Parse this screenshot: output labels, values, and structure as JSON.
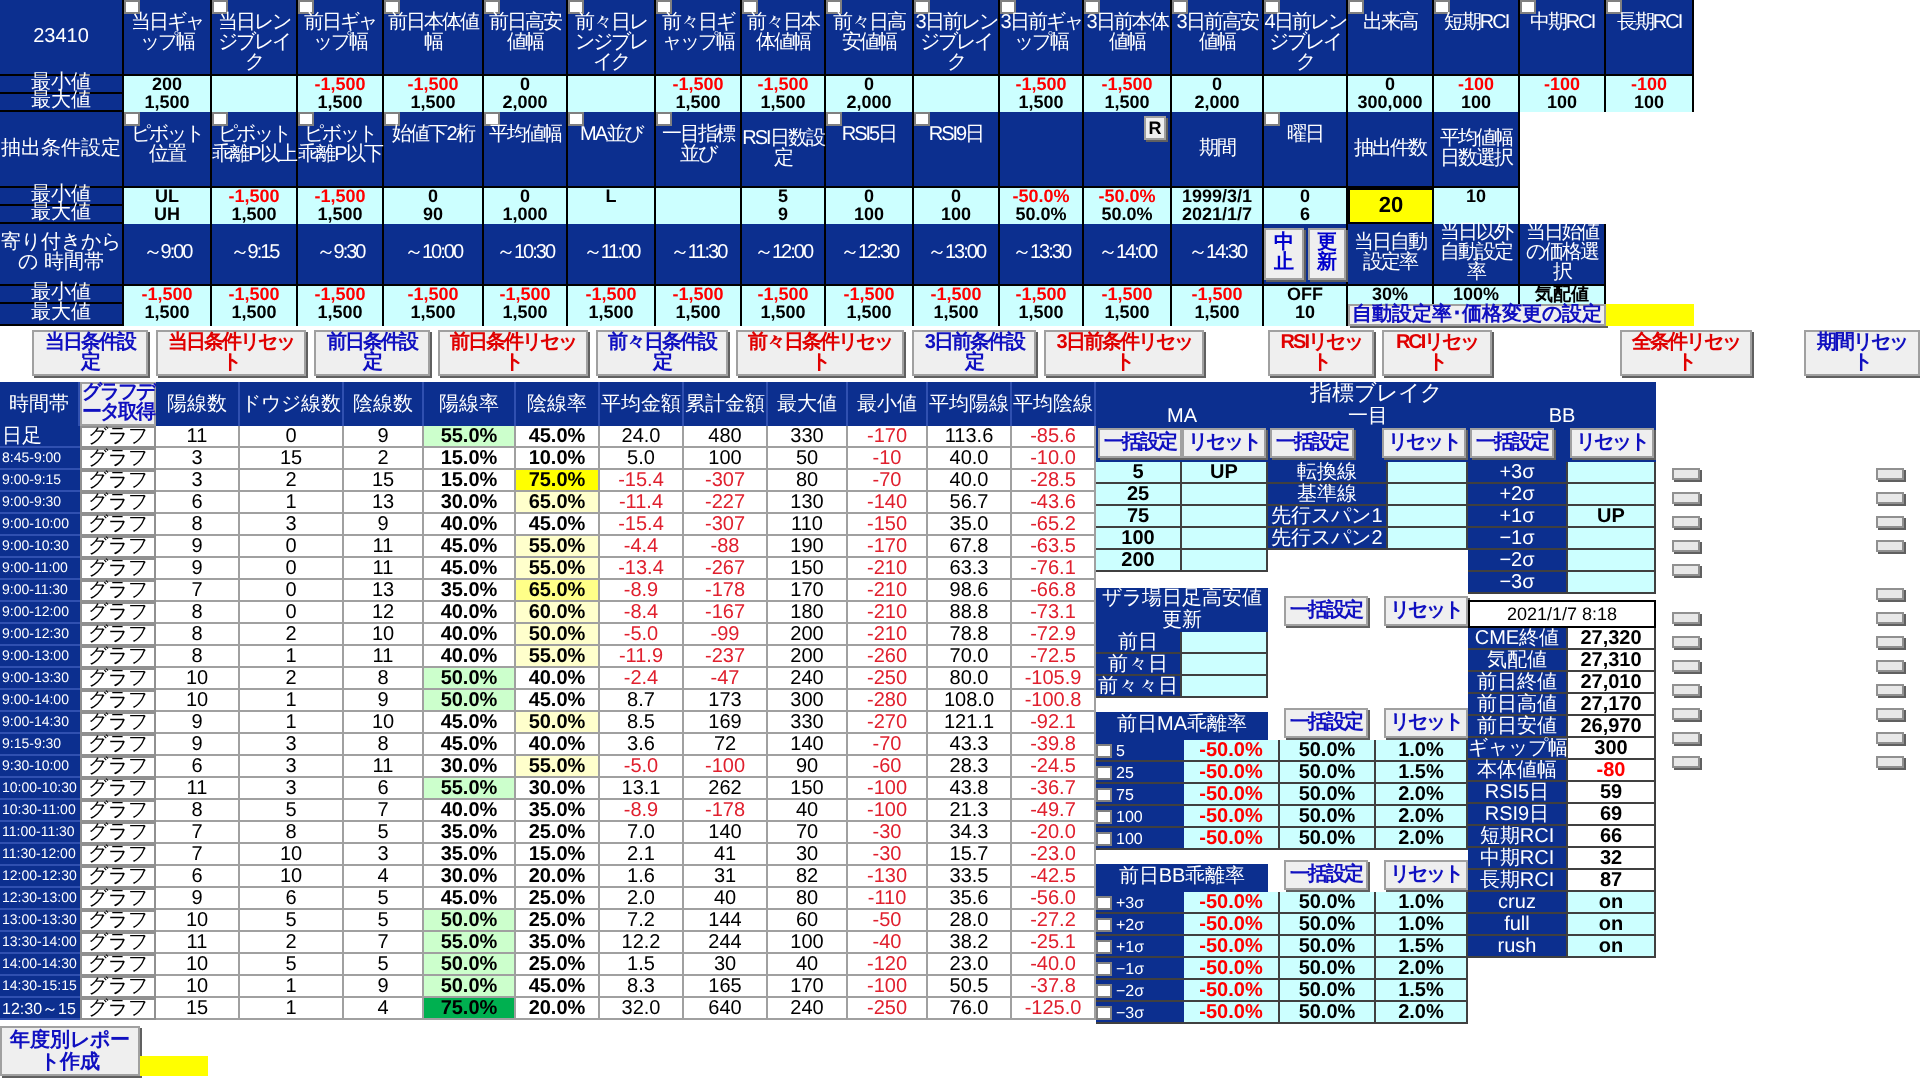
{
  "bands": [
    {
      "label": "23410",
      "min_label": "最小値",
      "max_label": "最大値",
      "columns": [
        {
          "kind": "check",
          "label": "当日ギャップ幅",
          "checked": false,
          "min": "200",
          "max": "1,500"
        },
        {
          "kind": "check",
          "label": "当日レンジブレイク",
          "checked": false
        },
        {
          "kind": "check",
          "label": "前日ギャップ幅",
          "checked": false,
          "min": "-1,500",
          "max": "1,500"
        },
        {
          "kind": "check",
          "label": "前日本体値幅",
          "checked": false,
          "min": "-1,500",
          "max": "1,500"
        },
        {
          "kind": "check",
          "label": "前日高安値幅",
          "checked": false,
          "min": "0",
          "max": "2,000"
        },
        {
          "kind": "check",
          "label": "前々日レンジブレイク",
          "checked": false
        },
        {
          "kind": "check",
          "label": "前々日ギャップ幅",
          "checked": false,
          "min": "-1,500",
          "max": "1,500"
        },
        {
          "kind": "check",
          "label": "前々日本体値幅",
          "checked": false,
          "min": "-1,500",
          "max": "1,500"
        },
        {
          "kind": "check",
          "label": "前々日高安値幅",
          "checked": false,
          "min": "0",
          "max": "2,000"
        },
        {
          "kind": "check",
          "label": "3日前レンジブレイク",
          "checked": false
        },
        {
          "kind": "check",
          "label": "3日前ギャップ幅",
          "checked": false,
          "min": "-1,500",
          "max": "1,500"
        },
        {
          "kind": "check",
          "label": "3日前本体値幅",
          "checked": false,
          "min": "-1,500",
          "max": "1,500"
        },
        {
          "kind": "check",
          "label": "3日前高安値幅",
          "checked": false,
          "min": "0",
          "max": "2,000"
        },
        {
          "kind": "check",
          "label": "4日前レンジブレイク",
          "checked": false
        },
        {
          "kind": "check",
          "label": "出来高",
          "checked": false,
          "min": "0",
          "max": "300,000"
        },
        {
          "kind": "check",
          "label": "短期RCI",
          "checked": false,
          "min": "-100",
          "max": "100"
        },
        {
          "kind": "check",
          "label": "中期RCI",
          "checked": false,
          "min": "-100",
          "max": "100"
        },
        {
          "kind": "check",
          "label": "長期RCI",
          "checked": false,
          "min": "-100",
          "max": "100"
        }
      ]
    },
    {
      "label": "抽出条件設定",
      "min_label": "最小値",
      "max_label": "最大値",
      "columns": [
        {
          "kind": "check",
          "label": "ピボット位置",
          "checked": false,
          "min": "UL",
          "max": "UH"
        },
        {
          "kind": "check",
          "label": "ピボット乖離P以上",
          "checked": false,
          "min": "-1,500",
          "max": "1,500"
        },
        {
          "kind": "check",
          "label": "ピボット乖離P以下",
          "checked": false,
          "min": "-1,500",
          "max": "1,500"
        },
        {
          "kind": "check",
          "label": "始値下2桁",
          "checked": false,
          "min": "0",
          "max": "90"
        },
        {
          "kind": "check",
          "label": "平均値幅",
          "checked": false,
          "min": "0",
          "max": "1,000"
        },
        {
          "kind": "check",
          "label": "MA並び",
          "checked": false,
          "min": "L"
        },
        {
          "kind": "check",
          "label": "一目指標並び",
          "checked": false
        },
        {
          "kind": "plain",
          "label": "RSI日数設定",
          "min": "5",
          "max": "9"
        },
        {
          "kind": "check",
          "label": "RSI5日",
          "checked": false,
          "min": "0",
          "max": "100"
        },
        {
          "kind": "check",
          "label": "RSI9日",
          "checked": false,
          "min": "0",
          "max": "100"
        },
        {
          "kind": "blank",
          "min": "-50.0%",
          "max": "50.0%"
        },
        {
          "kind": "button",
          "button": "R",
          "min": "-50.0%",
          "max": "50.0%"
        },
        {
          "kind": "plain",
          "label": "期間",
          "min": "1999/3/1",
          "max": "2021/1/7"
        },
        {
          "kind": "check",
          "label": "曜日",
          "checked": false,
          "min": "0",
          "max": "6"
        },
        {
          "kind": "plain",
          "label": "抽出件数",
          "count": "20"
        },
        {
          "kind": "plain",
          "label": "平均値幅日数選択",
          "min": "10"
        },
        {
          "kind": "empty"
        },
        {
          "kind": "empty"
        }
      ]
    },
    {
      "label": "寄り付きからの 時間帯",
      "min_label": "最小値",
      "max_label": "最大値",
      "action_button": "自動設定率･価格変更の設定",
      "columns": [
        {
          "kind": "plain",
          "label": "～9:00",
          "min": "-1,500",
          "max": "1,500"
        },
        {
          "kind": "plain",
          "label": "～9:15",
          "min": "-1,500",
          "max": "1,500"
        },
        {
          "kind": "plain",
          "label": "～9:30",
          "min": "-1,500",
          "max": "1,500"
        },
        {
          "kind": "plain",
          "label": "～10:00",
          "min": "-1,500",
          "max": "1,500"
        },
        {
          "kind": "plain",
          "label": "～10:30",
          "min": "-1,500",
          "max": "1,500"
        },
        {
          "kind": "plain",
          "label": "～11:00",
          "min": "-1,500",
          "max": "1,500"
        },
        {
          "kind": "plain",
          "label": "～11:30",
          "min": "-1,500",
          "max": "1,500"
        },
        {
          "kind": "plain",
          "label": "～12:00",
          "min": "-1,500",
          "max": "1,500"
        },
        {
          "kind": "plain",
          "label": "～12:30",
          "min": "-1,500",
          "max": "1,500"
        },
        {
          "kind": "plain",
          "label": "～13:00",
          "min": "-1,500",
          "max": "1,500"
        },
        {
          "kind": "plain",
          "label": "～13:30",
          "min": "-1,500",
          "max": "1,500"
        },
        {
          "kind": "plain",
          "label": "～14:00",
          "min": "-1,500",
          "max": "1,500"
        },
        {
          "kind": "plain",
          "label": "～14:30",
          "min": "-1,500",
          "max": "1,500"
        },
        {
          "kind": "controls",
          "buttons": [
            "中止",
            "更新"
          ],
          "min": "OFF",
          "max": "10"
        },
        {
          "kind": "plain",
          "label": "当日自動設定率",
          "min": "30%"
        },
        {
          "kind": "plain",
          "label": "当日以外自動設定率",
          "min": "100%"
        },
        {
          "kind": "plain",
          "label": "当日始値の価格選択",
          "min": "気配値"
        },
        {
          "kind": "empty"
        }
      ]
    }
  ],
  "condition_buttons": [
    {
      "kind": "set",
      "label": "当日条件設定"
    },
    {
      "kind": "reset",
      "label": "当日条件リセット"
    },
    {
      "kind": "set",
      "label": "前日条件設定"
    },
    {
      "kind": "reset",
      "label": "前日条件リセット"
    },
    {
      "kind": "set",
      "label": "前々日条件設定"
    },
    {
      "kind": "reset",
      "label": "前々日条件リセット"
    },
    {
      "kind": "set",
      "label": "3日前条件設定"
    },
    {
      "kind": "reset",
      "label": "3日前条件リセット"
    },
    {
      "kind": "reset",
      "label": "RSIリセット"
    },
    {
      "kind": "reset",
      "label": "RCIリセット"
    },
    {
      "kind": "reset",
      "label": "全条件リセット"
    },
    {
      "kind": "set",
      "label": "期間リセット"
    }
  ],
  "main_table": {
    "corner": "時間帯",
    "graph_button": "グラフデータ取得",
    "columns": [
      "陽線数",
      "ドウジ線数",
      "陰線数",
      "陽線率",
      "陰線率",
      "平均金額",
      "累計金額",
      "最大値",
      "最小値",
      "平均陽線",
      "平均陰線"
    ],
    "rows": [
      {
        "kind": "daily",
        "time": "日足",
        "button": "グラフ",
        "values": [
          "11",
          "0",
          "9",
          "55.0%",
          "45.0%",
          "24.0",
          "480",
          "330",
          "-170",
          "113.6",
          "-85.6"
        ],
        "highlights": [
          {
            "color": "#ccffcc"
          },
          {
            "color": "#ffffff"
          }
        ]
      },
      {
        "kind": "slot",
        "time": "8:45-9:00",
        "button": "グラフ",
        "values": [
          "3",
          "15",
          "2",
          "15.0%",
          "10.0%",
          "5.0",
          "100",
          "50",
          "-10",
          "40.0",
          "-10.0"
        ],
        "highlights": [
          {
            "color": "#ffffff"
          },
          {
            "color": "#ffffff"
          }
        ]
      },
      {
        "kind": "slot",
        "time": "9:00-9:15",
        "button": "グラフ",
        "values": [
          "3",
          "2",
          "15",
          "15.0%",
          "75.0%",
          "-15.4",
          "-307",
          "80",
          "-70",
          "40.0",
          "-28.5"
        ],
        "highlights": [
          {
            "color": "#ffffff"
          },
          {
            "color": "#ffff00"
          }
        ]
      },
      {
        "kind": "slot",
        "time": "9:00-9:30",
        "button": "グラフ",
        "values": [
          "6",
          "1",
          "13",
          "30.0%",
          "65.0%",
          "-11.4",
          "-227",
          "130",
          "-140",
          "56.7",
          "-43.6"
        ],
        "highlights": [
          {
            "color": "#ffffff"
          },
          {
            "color": "#ffffcc"
          }
        ]
      },
      {
        "kind": "slot",
        "time": "9:00-10:00",
        "button": "グラフ",
        "values": [
          "8",
          "3",
          "9",
          "40.0%",
          "45.0%",
          "-15.4",
          "-307",
          "110",
          "-150",
          "35.0",
          "-65.2"
        ],
        "highlights": [
          {
            "color": "#ffffff"
          },
          {
            "color": "#ffffff"
          }
        ]
      },
      {
        "kind": "slot",
        "time": "9:00-10:30",
        "button": "グラフ",
        "values": [
          "9",
          "0",
          "11",
          "45.0%",
          "55.0%",
          "-4.4",
          "-88",
          "190",
          "-170",
          "67.8",
          "-63.5"
        ],
        "highlights": [
          {
            "color": "#ffffff"
          },
          {
            "color": "#ffffcc"
          }
        ]
      },
      {
        "kind": "slot",
        "time": "9:00-11:00",
        "button": "グラフ",
        "values": [
          "9",
          "0",
          "11",
          "45.0%",
          "55.0%",
          "-13.4",
          "-267",
          "150",
          "-210",
          "63.3",
          "-76.1"
        ],
        "highlights": [
          {
            "color": "#ffffff"
          },
          {
            "color": "#ffffcc"
          }
        ]
      },
      {
        "kind": "slot",
        "time": "9:00-11:30",
        "button": "グラフ",
        "values": [
          "7",
          "0",
          "13",
          "35.0%",
          "65.0%",
          "-8.9",
          "-178",
          "170",
          "-210",
          "98.6",
          "-66.8"
        ],
        "highlights": [
          {
            "color": "#ffffff"
          },
          {
            "color": "#ffff88"
          }
        ]
      },
      {
        "kind": "slot",
        "time": "9:00-12:00",
        "button": "グラフ",
        "values": [
          "8",
          "0",
          "12",
          "40.0%",
          "60.0%",
          "-8.4",
          "-167",
          "180",
          "-210",
          "88.8",
          "-73.1"
        ],
        "highlights": [
          {
            "color": "#ffffff"
          },
          {
            "color": "#ffffcc"
          }
        ]
      },
      {
        "kind": "slot",
        "time": "9:00-12:30",
        "button": "グラフ",
        "values": [
          "8",
          "2",
          "10",
          "40.0%",
          "50.0%",
          "-5.0",
          "-99",
          "200",
          "-210",
          "78.8",
          "-72.9"
        ],
        "highlights": [
          {
            "color": "#ffffff"
          },
          {
            "color": "#ffffcc"
          }
        ]
      },
      {
        "kind": "slot",
        "time": "9:00-13:00",
        "button": "グラフ",
        "values": [
          "8",
          "1",
          "11",
          "40.0%",
          "55.0%",
          "-11.9",
          "-237",
          "200",
          "-260",
          "70.0",
          "-72.5"
        ],
        "highlights": [
          {
            "color": "#ffffff"
          },
          {
            "color": "#ffffcc"
          }
        ]
      },
      {
        "kind": "slot",
        "time": "9:00-13:30",
        "button": "グラフ",
        "values": [
          "10",
          "2",
          "8",
          "50.0%",
          "40.0%",
          "-2.4",
          "-47",
          "240",
          "-250",
          "80.0",
          "-105.9"
        ],
        "highlights": [
          {
            "color": "#ccffcc"
          },
          {
            "color": "#ffffff"
          }
        ]
      },
      {
        "kind": "slot",
        "time": "9:00-14:00",
        "button": "グラフ",
        "values": [
          "10",
          "1",
          "9",
          "50.0%",
          "45.0%",
          "8.7",
          "173",
          "300",
          "-280",
          "108.0",
          "-100.8"
        ],
        "highlights": [
          {
            "color": "#ccffcc"
          },
          {
            "color": "#ffffff"
          }
        ]
      },
      {
        "kind": "slot",
        "time": "9:00-14:30",
        "button": "グラフ",
        "values": [
          "9",
          "1",
          "10",
          "45.0%",
          "50.0%",
          "8.5",
          "169",
          "330",
          "-270",
          "121.1",
          "-92.1"
        ],
        "highlights": [
          {
            "color": "#ffffff"
          },
          {
            "color": "#ffffcc"
          }
        ]
      },
      {
        "kind": "slot",
        "time": "9:15-9:30",
        "button": "グラフ",
        "values": [
          "9",
          "3",
          "8",
          "45.0%",
          "40.0%",
          "3.6",
          "72",
          "140",
          "-70",
          "43.3",
          "-39.8"
        ],
        "highlights": [
          {
            "color": "#ffffff"
          },
          {
            "color": "#ffffff"
          }
        ]
      },
      {
        "kind": "slot",
        "time": "9:30-10:00",
        "button": "グラフ",
        "values": [
          "6",
          "3",
          "11",
          "30.0%",
          "55.0%",
          "-5.0",
          "-100",
          "90",
          "-60",
          "28.3",
          "-24.5"
        ],
        "highlights": [
          {
            "color": "#ffffff"
          },
          {
            "color": "#ffffcc"
          }
        ]
      },
      {
        "kind": "slot",
        "time": "10:00-10:30",
        "button": "グラフ",
        "values": [
          "11",
          "3",
          "6",
          "55.0%",
          "30.0%",
          "13.1",
          "262",
          "150",
          "-100",
          "43.8",
          "-36.7"
        ],
        "highlights": [
          {
            "color": "#ccffcc"
          },
          {
            "color": "#ffffff"
          }
        ]
      },
      {
        "kind": "slot",
        "time": "10:30-11:00",
        "button": "グラフ",
        "values": [
          "8",
          "5",
          "7",
          "40.0%",
          "35.0%",
          "-8.9",
          "-178",
          "40",
          "-100",
          "21.3",
          "-49.7"
        ],
        "highlights": [
          {
            "color": "#ffffff"
          },
          {
            "color": "#ffffff"
          }
        ]
      },
      {
        "kind": "slot",
        "time": "11:00-11:30",
        "button": "グラフ",
        "values": [
          "7",
          "8",
          "5",
          "35.0%",
          "25.0%",
          "7.0",
          "140",
          "70",
          "-30",
          "34.3",
          "-20.0"
        ],
        "highlights": [
          {
            "color": "#ffffff"
          },
          {
            "color": "#ffffff"
          }
        ]
      },
      {
        "kind": "slot",
        "time": "11:30-12:00",
        "button": "グラフ",
        "values": [
          "7",
          "10",
          "3",
          "35.0%",
          "15.0%",
          "2.1",
          "41",
          "30",
          "-30",
          "15.7",
          "-23.0"
        ],
        "highlights": [
          {
            "color": "#ffffff"
          },
          {
            "color": "#ffffff"
          }
        ]
      },
      {
        "kind": "slot",
        "time": "12:00-12:30",
        "button": "グラフ",
        "values": [
          "6",
          "10",
          "4",
          "30.0%",
          "20.0%",
          "1.6",
          "31",
          "82",
          "-130",
          "33.5",
          "-42.5"
        ],
        "highlights": [
          {
            "color": "#ffffff"
          },
          {
            "color": "#ffffff"
          }
        ]
      },
      {
        "kind": "slot",
        "time": "12:30-13:00",
        "button": "グラフ",
        "values": [
          "9",
          "6",
          "5",
          "45.0%",
          "25.0%",
          "2.0",
          "40",
          "80",
          "-110",
          "35.6",
          "-56.0"
        ],
        "highlights": [
          {
            "color": "#ffffff"
          },
          {
            "color": "#ffffff"
          }
        ]
      },
      {
        "kind": "slot",
        "time": "13:00-13:30",
        "button": "グラフ",
        "values": [
          "10",
          "5",
          "5",
          "50.0%",
          "25.0%",
          "7.2",
          "144",
          "60",
          "-50",
          "28.0",
          "-27.2"
        ],
        "highlights": [
          {
            "color": "#ccffcc"
          },
          {
            "color": "#ffffff"
          }
        ]
      },
      {
        "kind": "slot",
        "time": "13:30-14:00",
        "button": "グラフ",
        "values": [
          "11",
          "2",
          "7",
          "55.0%",
          "35.0%",
          "12.2",
          "244",
          "100",
          "-40",
          "38.2",
          "-25.1"
        ],
        "highlights": [
          {
            "color": "#ccffcc"
          },
          {
            "color": "#ffffff"
          }
        ]
      },
      {
        "kind": "slot",
        "time": "14:00-14:30",
        "button": "グラフ",
        "values": [
          "10",
          "5",
          "5",
          "50.0%",
          "25.0%",
          "1.5",
          "30",
          "40",
          "-120",
          "23.0",
          "-40.0"
        ],
        "highlights": [
          {
            "color": "#ccffcc"
          },
          {
            "color": "#ffffff"
          }
        ]
      },
      {
        "kind": "slot",
        "time": "14:30-15:15",
        "button": "グラフ",
        "values": [
          "10",
          "1",
          "9",
          "50.0%",
          "45.0%",
          "8.3",
          "165",
          "170",
          "-100",
          "50.5",
          "-37.8"
        ],
        "highlights": [
          {
            "color": "#ccffcc"
          },
          {
            "color": "#ffffff"
          }
        ]
      },
      {
        "kind": "range",
        "time": "12:30～15",
        "button": "グラフ",
        "values": [
          "15",
          "1",
          "4",
          "75.0%",
          "20.0%",
          "32.0",
          "640",
          "240",
          "-250",
          "76.0",
          "-125.0"
        ],
        "highlights": [
          {
            "color": "#00b050"
          },
          {
            "color": "#ffffff"
          }
        ]
      }
    ]
  },
  "report_button": "年度別レポート作成",
  "indicator_break": {
    "title": "指標ブレイク",
    "groups": [
      {
        "label": "MA",
        "set_button": "一括設定",
        "reset_button": "リセット"
      },
      {
        "label": "一目",
        "set_button": "一括設定",
        "reset_button": "リセット"
      },
      {
        "label": "BB",
        "set_button": "一括設定",
        "reset_button": "リセット"
      }
    ],
    "ma": [
      {
        "label": "5",
        "value": "UP"
      },
      {
        "label": "25"
      },
      {
        "label": "75"
      },
      {
        "label": "100"
      },
      {
        "label": "200"
      }
    ],
    "ichimoku": [
      {
        "label": "転換線"
      },
      {
        "label": "基準線"
      },
      {
        "label": "先行スパン1"
      },
      {
        "label": "先行スパン2"
      }
    ],
    "bb": [
      {
        "label": "+3σ"
      },
      {
        "label": "+2σ"
      },
      {
        "label": "+1σ",
        "value": "UP"
      },
      {
        "label": "−1σ"
      },
      {
        "label": "−2σ"
      },
      {
        "label": "−3σ"
      }
    ]
  },
  "zaraba": {
    "title": "ザラ場日足高安値更新",
    "set_button": "一括設定",
    "reset_button": "リセット",
    "rows": [
      {
        "label": "前日"
      },
      {
        "label": "前々日"
      },
      {
        "label": "前々々日"
      }
    ]
  },
  "ma_deviation": {
    "title": "前日MA乖離率",
    "set_button": "一括設定",
    "reset_button": "リセット",
    "rows": [
      {
        "label": "5",
        "checked": false,
        "min": "-50.0%",
        "max": "50.0%",
        "rate": "1.0%"
      },
      {
        "label": "25",
        "checked": false,
        "min": "-50.0%",
        "max": "50.0%",
        "rate": "1.5%"
      },
      {
        "label": "75",
        "checked": false,
        "min": "-50.0%",
        "max": "50.0%",
        "rate": "2.0%"
      },
      {
        "label": "100",
        "checked": false,
        "min": "-50.0%",
        "max": "50.0%",
        "rate": "2.0%"
      },
      {
        "label": "100",
        "checked": false,
        "min": "-50.0%",
        "max": "50.0%",
        "rate": "2.0%"
      }
    ]
  },
  "bb_deviation": {
    "title": "前日BB乖離率",
    "set_button": "一括設定",
    "reset_button": "リセット",
    "rows": [
      {
        "label": "+3σ",
        "checked": false,
        "min": "-50.0%",
        "max": "50.0%",
        "rate": "1.0%"
      },
      {
        "label": "+2σ",
        "checked": false,
        "min": "-50.0%",
        "max": "50.0%",
        "rate": "1.0%"
      },
      {
        "label": "+1σ",
        "checked": false,
        "min": "-50.0%",
        "max": "50.0%",
        "rate": "1.5%"
      },
      {
        "label": "−1σ",
        "checked": false,
        "min": "-50.0%",
        "max": "50.0%",
        "rate": "2.0%"
      },
      {
        "label": "−2σ",
        "checked": false,
        "min": "-50.0%",
        "max": "50.0%",
        "rate": "1.5%"
      },
      {
        "label": "−3σ",
        "checked": false,
        "min": "-50.0%",
        "max": "50.0%",
        "rate": "2.0%"
      }
    ]
  },
  "market": {
    "timestamp": "2021/1/7 8:18",
    "rows": [
      {
        "kind": "price",
        "label": "CME終値",
        "value": "27,320"
      },
      {
        "kind": "price",
        "label": "気配値",
        "value": "27,310"
      },
      {
        "kind": "price",
        "label": "前日終値",
        "value": "27,010"
      },
      {
        "kind": "price",
        "label": "前日高値",
        "value": "27,170"
      },
      {
        "kind": "price",
        "label": "前日安値",
        "value": "26,970"
      },
      {
        "kind": "price",
        "label": "ギャップ幅",
        "value": "300"
      },
      {
        "kind": "price",
        "label": "本体値幅",
        "value": "-80"
      },
      {
        "kind": "price",
        "label": "RSI5日",
        "value": "59"
      },
      {
        "kind": "price",
        "label": "RSI9日",
        "value": "69"
      },
      {
        "kind": "price",
        "label": "短期RCI",
        "value": "66"
      },
      {
        "kind": "price",
        "label": "中期RCI",
        "value": "32"
      },
      {
        "kind": "price",
        "label": "長期RCI",
        "value": "87"
      },
      {
        "kind": "flag",
        "label": "cruz",
        "value": "on"
      },
      {
        "kind": "flag",
        "label": "full",
        "value": "on"
      },
      {
        "kind": "flag",
        "label": "rush",
        "value": "on"
      }
    ]
  }
}
